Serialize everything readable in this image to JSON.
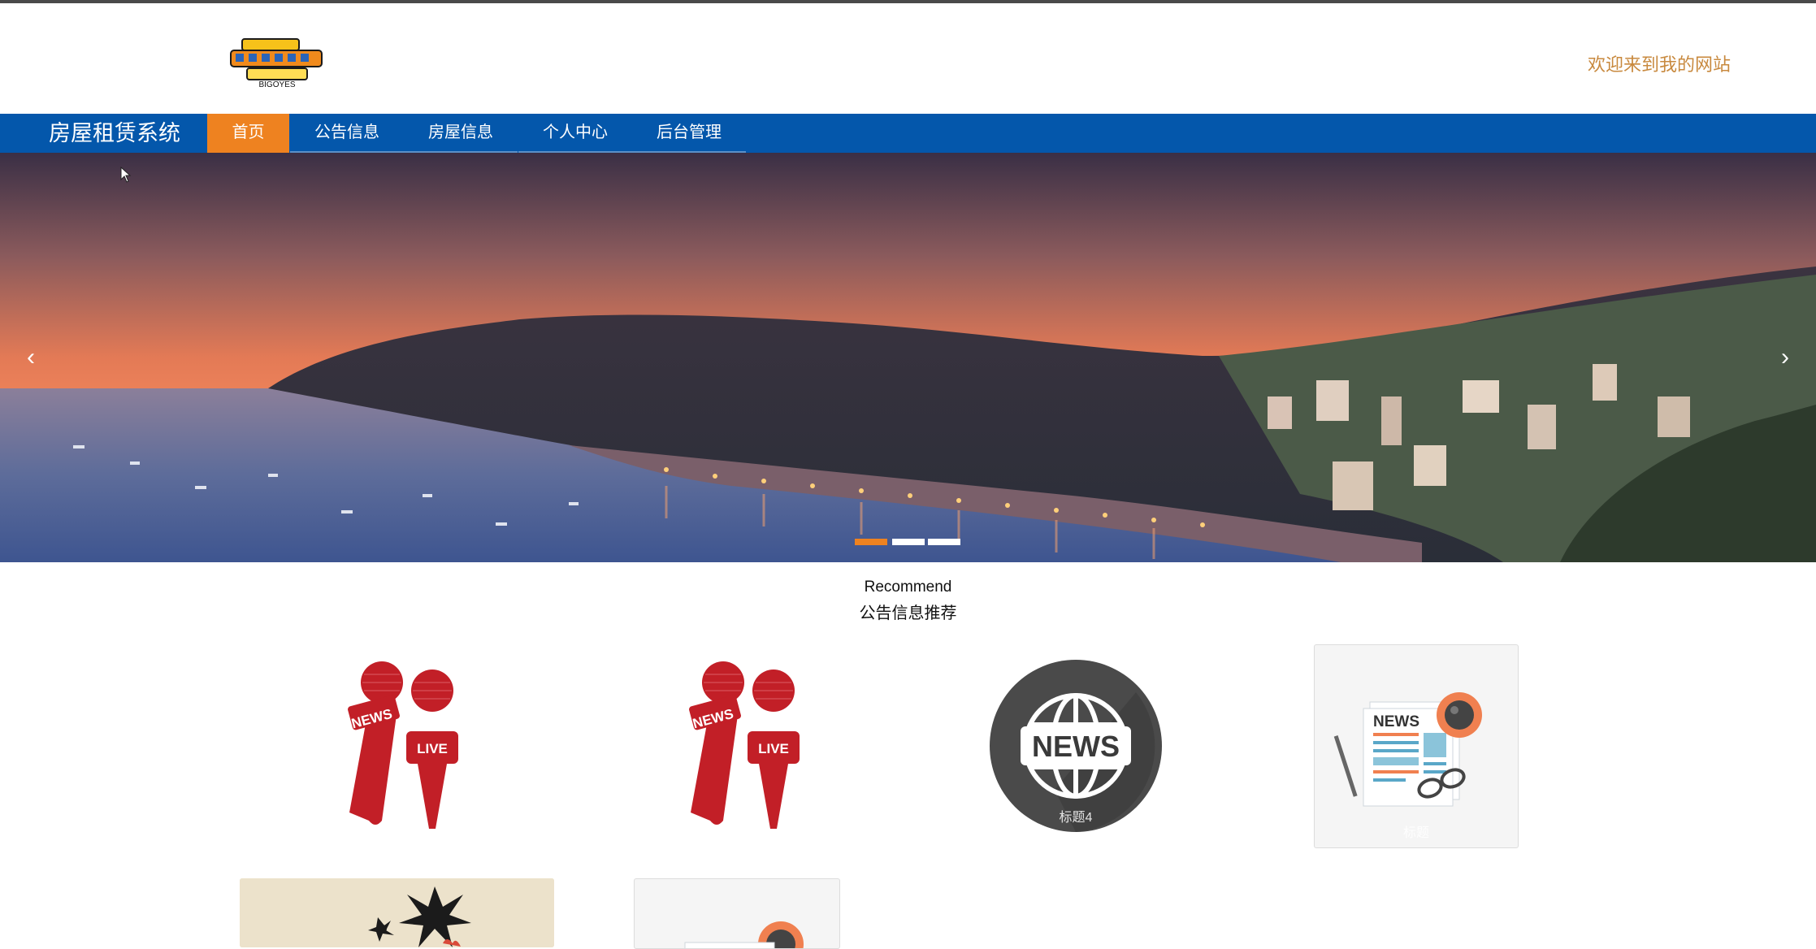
{
  "header": {
    "logo_name": "BIGOYES",
    "welcome_text": "欢迎来到我的网站"
  },
  "nav": {
    "brand": "房屋租赁系统",
    "items": [
      {
        "label": "首页",
        "active": true
      },
      {
        "label": "公告信息",
        "active": false
      },
      {
        "label": "房屋信息",
        "active": false
      },
      {
        "label": "个人中心",
        "active": false
      },
      {
        "label": "后台管理",
        "active": false
      }
    ]
  },
  "carousel": {
    "prev_icon": "chevron-left-icon",
    "next_icon": "chevron-right-icon",
    "slides": 3,
    "active_slide": 1
  },
  "recommend": {
    "title_en": "Recommend",
    "title_cn": "公告信息推荐",
    "cards": [
      {
        "label": "",
        "icon": "news-live-microphones-icon"
      },
      {
        "label": "",
        "icon": "news-live-microphones-icon"
      },
      {
        "label": "标题4",
        "icon": "news-globe-icon"
      },
      {
        "label": "标题",
        "icon": "newspaper-coffee-icon"
      }
    ]
  },
  "badge_texts": {
    "news": "NEWS",
    "live": "LIVE"
  },
  "colors": {
    "nav_bg": "#0457ab",
    "nav_active": "#ee8220",
    "welcome": "#c8893e",
    "mic_red": "#c21f27"
  }
}
